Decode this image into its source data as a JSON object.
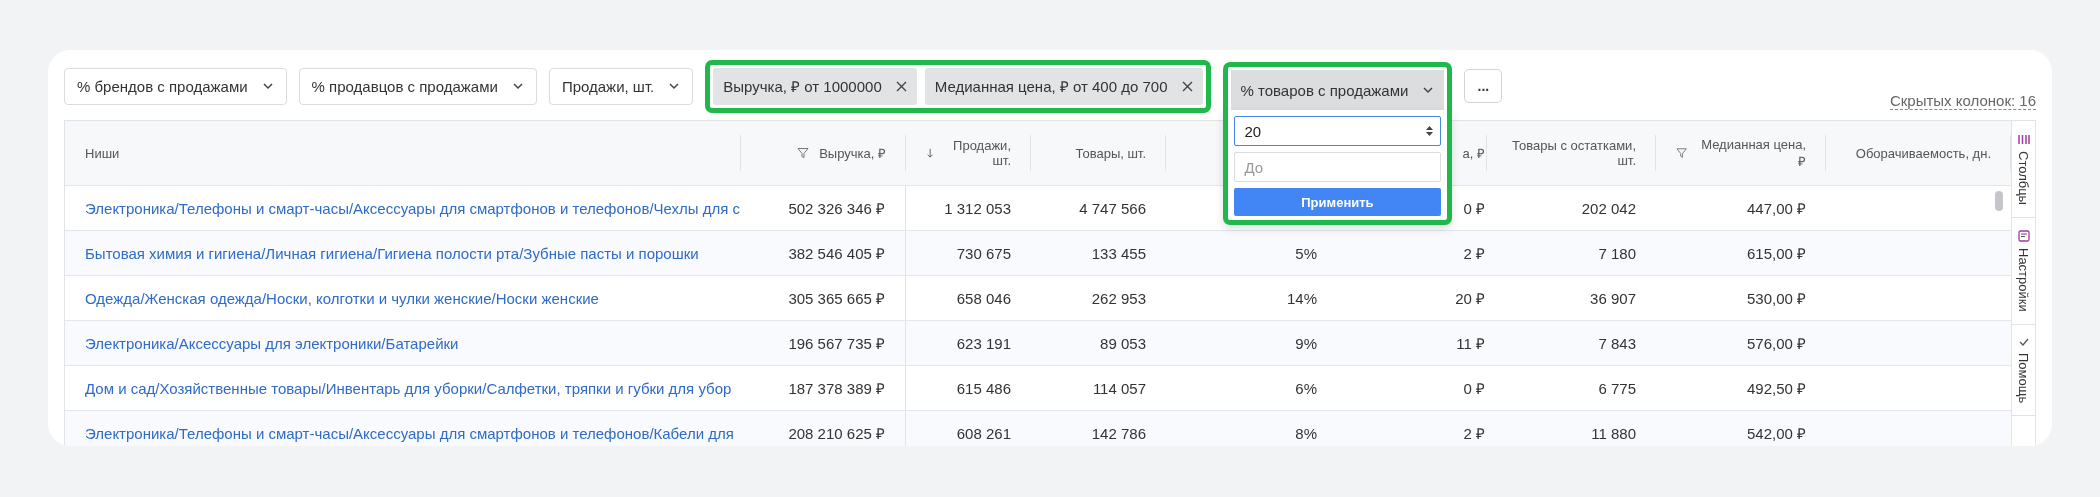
{
  "filters": {
    "dropdowns": [
      "% брендов с продажами",
      "% продавцов с продажами",
      "Продажи, шт."
    ],
    "active_chips": [
      {
        "label": "Выручка, ₽ от 1000000"
      },
      {
        "label": "Медианная цена, ₽ от 400 до 700"
      }
    ],
    "open_dropdown": {
      "label": "% товаров с продажами",
      "from_value": "20",
      "to_placeholder": "До",
      "apply_button": "Применить"
    },
    "more_button": "...",
    "hidden_columns": "Скрытых колонок: 16"
  },
  "table": {
    "columns": [
      {
        "label": "Ниши"
      },
      {
        "label": "Выручка, ₽"
      },
      {
        "label": "Продажи, шт."
      },
      {
        "label": "Товары, шт."
      },
      {},
      {
        "label": "а, ₽"
      },
      {
        "label": "Товары с остатками, шт."
      },
      {
        "label": "Медианная цена, ₽"
      },
      {
        "label": "Оборачиваемость, дн."
      }
    ],
    "rows": [
      {
        "niche": "Электроника/Телефоны и смарт-часы/Аксессуары для смартфонов и телефонов/Чехлы для с",
        "revenue": "502 326 346 ₽",
        "sales": "1 312 053",
        "products": "4 747 566",
        "column_6": "0 ₽",
        "stock": "202 042",
        "median_price": "447,00 ₽"
      },
      {
        "niche": "Бытовая химия и гигиена/Личная гигиена/Гигиена полости рта/Зубные пасты и порошки",
        "revenue": "382 546 405 ₽",
        "sales": "730 675",
        "products": "133 455",
        "column_5": "5%",
        "column_6": "2 ₽",
        "stock": "7 180",
        "median_price": "615,00 ₽"
      },
      {
        "niche": "Одежда/Женская одежда/Носки, колготки и чулки женские/Носки женские",
        "revenue": "305 365 665 ₽",
        "sales": "658 046",
        "products": "262 953",
        "column_5": "14%",
        "column_6": "20 ₽",
        "stock": "36 907",
        "median_price": "530,00 ₽"
      },
      {
        "niche": "Электроника/Аксессуары для электроники/Батарейки",
        "revenue": "196 567 735 ₽",
        "sales": "623 191",
        "products": "89 053",
        "column_5": "9%",
        "column_6": "11 ₽",
        "stock": "7 843",
        "median_price": "576,00 ₽"
      },
      {
        "niche": "Дом и сад/Хозяйственные товары/Инвентарь для уборки/Салфетки, тряпки и губки для убор",
        "revenue": "187 378 389 ₽",
        "sales": "615 486",
        "products": "114 057",
        "column_5": "6%",
        "column_6": "0 ₽",
        "stock": "6 775",
        "median_price": "492,50 ₽"
      },
      {
        "niche": "Электроника/Телефоны и смарт-часы/Аксессуары для смартфонов и телефонов/Кабели для",
        "revenue": "208 210 625 ₽",
        "sales": "608 261",
        "products": "142 786",
        "column_5": "8%",
        "column_6": "2 ₽",
        "stock": "11 880",
        "median_price": "542,00 ₽"
      }
    ]
  },
  "side_panel": [
    {
      "label": "Столбцы"
    },
    {
      "label": "Настройки"
    },
    {
      "label": "Помощь"
    }
  ]
}
